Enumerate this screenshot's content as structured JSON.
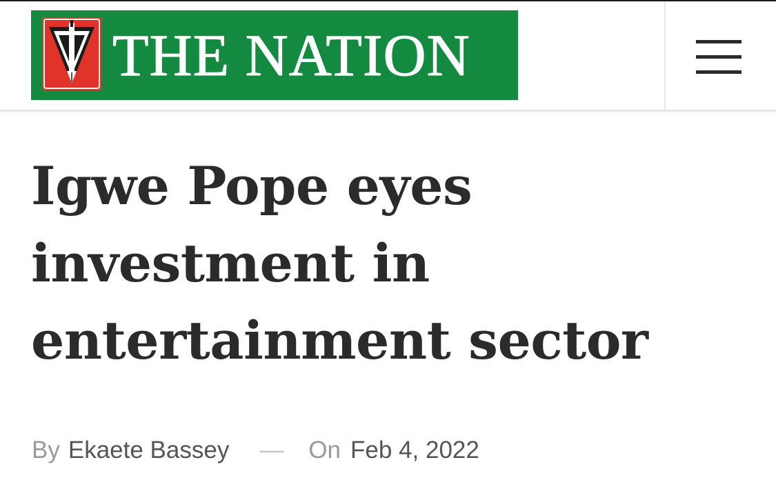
{
  "header": {
    "logo_text": "THE NATION",
    "menu_icon": "hamburger-menu-icon",
    "brand_green": "#138a3f",
    "brand_red": "#e0342b"
  },
  "article": {
    "headline": "Igwe Pope eyes investment in entertainment sector",
    "byline": {
      "by_label": "By",
      "author": "Ekaete Bassey",
      "separator": "—",
      "on_label": "On",
      "date": "Feb 4, 2022"
    }
  }
}
